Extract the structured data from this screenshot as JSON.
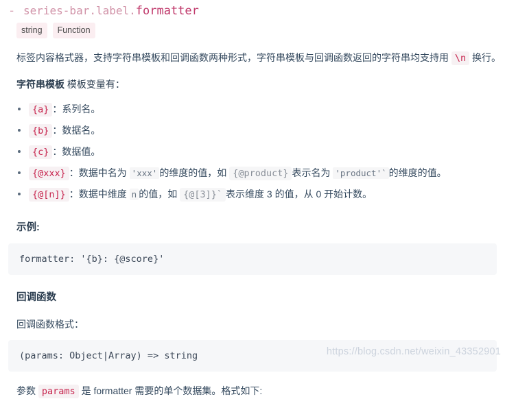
{
  "api": {
    "anchor_dash": "-",
    "path_prefix": "series-bar.label.",
    "property_name": "formatter",
    "badges": [
      {
        "label": "string"
      },
      {
        "label": "Function"
      }
    ]
  },
  "intro": {
    "text_before_code": "标签内容格式器，支持字符串模板和回调函数两种形式，字符串模板与回调函数返回的字符串均支持用",
    "inline_code": "\\n",
    "text_after_code": "换行。"
  },
  "string_template": {
    "bold_label": "字符串模板",
    "rest": " 模板变量有：",
    "items": [
      {
        "code": "{a}",
        "text": "：系列名。"
      },
      {
        "code": "{b}",
        "text": "：数据名。"
      },
      {
        "code": "{c}",
        "text": "：数据值。"
      },
      {
        "code": "{@xxx}",
        "text_1": "：数据中名为",
        "quoted_1": "'xxx'",
        "text_2": "的维度的值，如",
        "code_2": "{@product}",
        "text_3": "表示名为",
        "quoted_2": "'product'`",
        "text_4": "的维度的值。"
      },
      {
        "code": "{@[n]}",
        "text_1": "：数据中维度",
        "quoted_1": "n",
        "text_2": "的值，如",
        "code_2": "{@[3]}`",
        "text_3": "表示维度 3 的值，从 0 开始计数。"
      }
    ]
  },
  "example": {
    "heading": "示例:",
    "code": "formatter: '{b}: {@score}'"
  },
  "callback": {
    "heading": "回调函数",
    "format_label": "回调函数格式：",
    "code": "(params: Object|Array) => string",
    "params_text_1": "参数",
    "params_code": "params",
    "params_text_2": "是 formatter 需要的单个数据集。格式如下:"
  },
  "watermark": {
    "text": "https://blog.csdn.net/weixin_43352901"
  }
}
